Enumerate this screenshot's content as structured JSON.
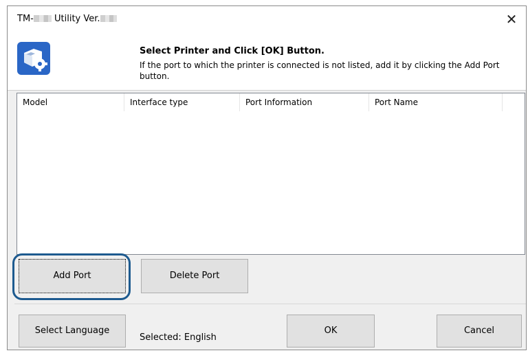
{
  "window": {
    "title_prefix": "TM-",
    "title_middle": " Utility Ver.",
    "close_glyph": "✕"
  },
  "header": {
    "title": "Select Printer and Click [OK] Button.",
    "description": "If the port to which the printer is connected is not listed, add it by clicking the Add Port button.",
    "icon": "printer-settings-icon"
  },
  "list": {
    "columns": [
      "Model",
      "Interface type",
      "Port Information",
      "Port Name"
    ],
    "rows": []
  },
  "buttons": {
    "add_port": "Add Port",
    "delete_port": "Delete Port",
    "select_language": "Select Language",
    "ok": "OK",
    "cancel": "Cancel"
  },
  "status": {
    "selected_language": "Selected: English"
  },
  "colors": {
    "highlight_ring": "#1d5a8f",
    "icon_blue": "#2a66c6"
  }
}
